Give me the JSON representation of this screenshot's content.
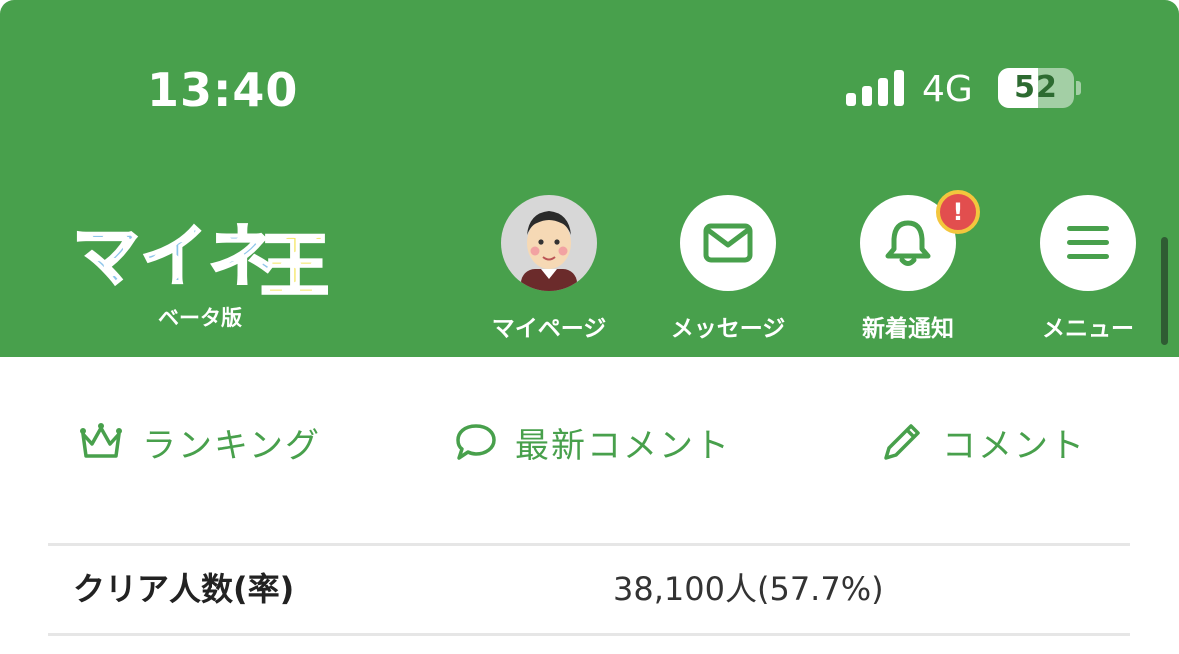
{
  "status_bar": {
    "time": "13:40",
    "network": "4G",
    "battery_level": "52",
    "battery_fraction": 0.52
  },
  "header": {
    "logo_text": "マイネ王",
    "logo_subtitle": "ベータ版",
    "nav": [
      {
        "label": "マイページ",
        "icon": "avatar"
      },
      {
        "label": "メッセージ",
        "icon": "envelope-icon"
      },
      {
        "label": "新着通知",
        "icon": "bell-icon",
        "badge": "!"
      },
      {
        "label": "メニュー",
        "icon": "hamburger-menu-icon"
      }
    ]
  },
  "tabs": [
    {
      "label": "ランキング",
      "icon": "crown-icon"
    },
    {
      "label": "最新コメント",
      "icon": "speech-bubble-icon"
    },
    {
      "label": "コメント",
      "icon": "pencil-icon"
    }
  ],
  "stats": [
    {
      "label": "クリア人数(率)",
      "value": "38,100人(57.7%)"
    }
  ],
  "colors": {
    "brand_green": "#48a04c",
    "badge_red": "#e24e4e",
    "badge_ring": "#f3c63d"
  }
}
